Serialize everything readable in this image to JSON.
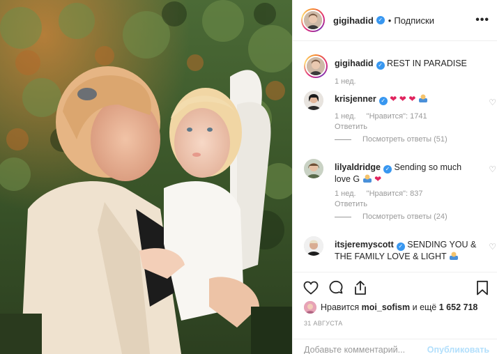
{
  "header": {
    "username": "gigihadid",
    "verified_glyph": "✓",
    "separator": "•",
    "follow_label": "Подписки",
    "more_glyph": "•••"
  },
  "caption": {
    "username": "gigihadid",
    "text": "REST IN PARADISE",
    "time": "1 нед."
  },
  "comments": [
    {
      "username": "krisjenner",
      "text": "",
      "emojis": [
        "❤",
        "❤",
        "❤"
      ],
      "time": "1 нед.",
      "likes": "\"Нравится\": 1741",
      "reply": "Ответить",
      "view_replies": "Посмотреть ответы (51)"
    },
    {
      "username": "lilyaldridge",
      "text": "Sending so much love G",
      "emojis": [
        "❤"
      ],
      "time": "1 нед.",
      "likes": "\"Нравится\": 837",
      "reply": "Ответить",
      "view_replies": "Посмотреть ответы (24)"
    },
    {
      "username": "itsjeremyscott",
      "text": "SENDING YOU & THE FAMILY LOVE & LIGHT",
      "emojis": [],
      "time": "",
      "likes": "",
      "reply": "",
      "view_replies": ""
    }
  ],
  "actions": {
    "icons": [
      "heart-icon",
      "comment-icon",
      "share-icon",
      "bookmark-icon"
    ]
  },
  "likes": {
    "prefix": "Нравится",
    "user": "moi_sofism",
    "middle": "и ещё",
    "count": "1 652 718"
  },
  "date": "31 АВГУСТА",
  "add_comment": {
    "placeholder": "Добавьте комментарий...",
    "publish_label": "Опубликовать"
  },
  "colors": {
    "accent": "#3897f0",
    "heart": "#e0245e",
    "publish_disabled": "#b2dffc",
    "muted": "#999999"
  }
}
